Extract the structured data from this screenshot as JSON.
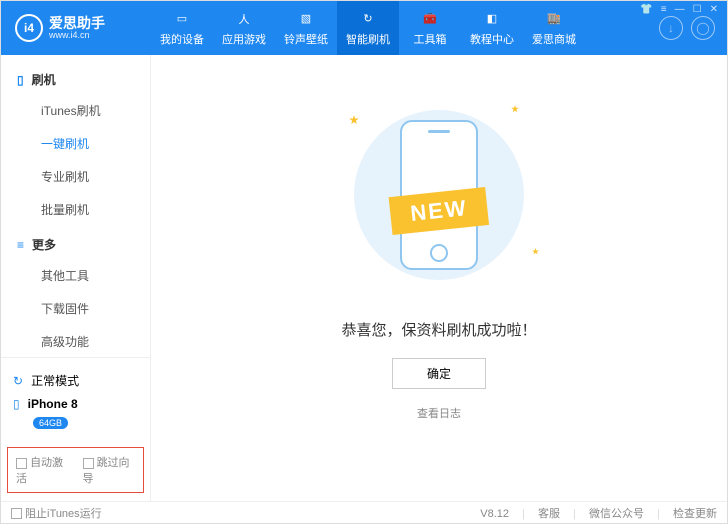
{
  "brand": {
    "name": "爱思助手",
    "url": "www.i4.cn"
  },
  "tabs": [
    {
      "label": "我的设备"
    },
    {
      "label": "应用游戏"
    },
    {
      "label": "铃声壁纸"
    },
    {
      "label": "智能刷机"
    },
    {
      "label": "工具箱"
    },
    {
      "label": "教程中心"
    },
    {
      "label": "爱思商城"
    }
  ],
  "sidebar": {
    "section1_title": "刷机",
    "section1_items": [
      "iTunes刷机",
      "一键刷机",
      "专业刷机",
      "批量刷机"
    ],
    "section2_title": "更多",
    "section2_items": [
      "其他工具",
      "下载固件",
      "高级功能"
    ]
  },
  "status": {
    "mode": "正常模式",
    "device": "iPhone 8",
    "storage": "64GB"
  },
  "options": {
    "auto_activate": "自动激活",
    "skip_guide": "跳过向导"
  },
  "main": {
    "ribbon": "NEW",
    "success_msg": "恭喜您，保资料刷机成功啦！",
    "ok_btn": "确定",
    "view_log": "查看日志"
  },
  "footer": {
    "block_itunes": "阻止iTunes运行",
    "version": "V8.12",
    "support": "客服",
    "wechat": "微信公众号",
    "update": "检查更新"
  }
}
